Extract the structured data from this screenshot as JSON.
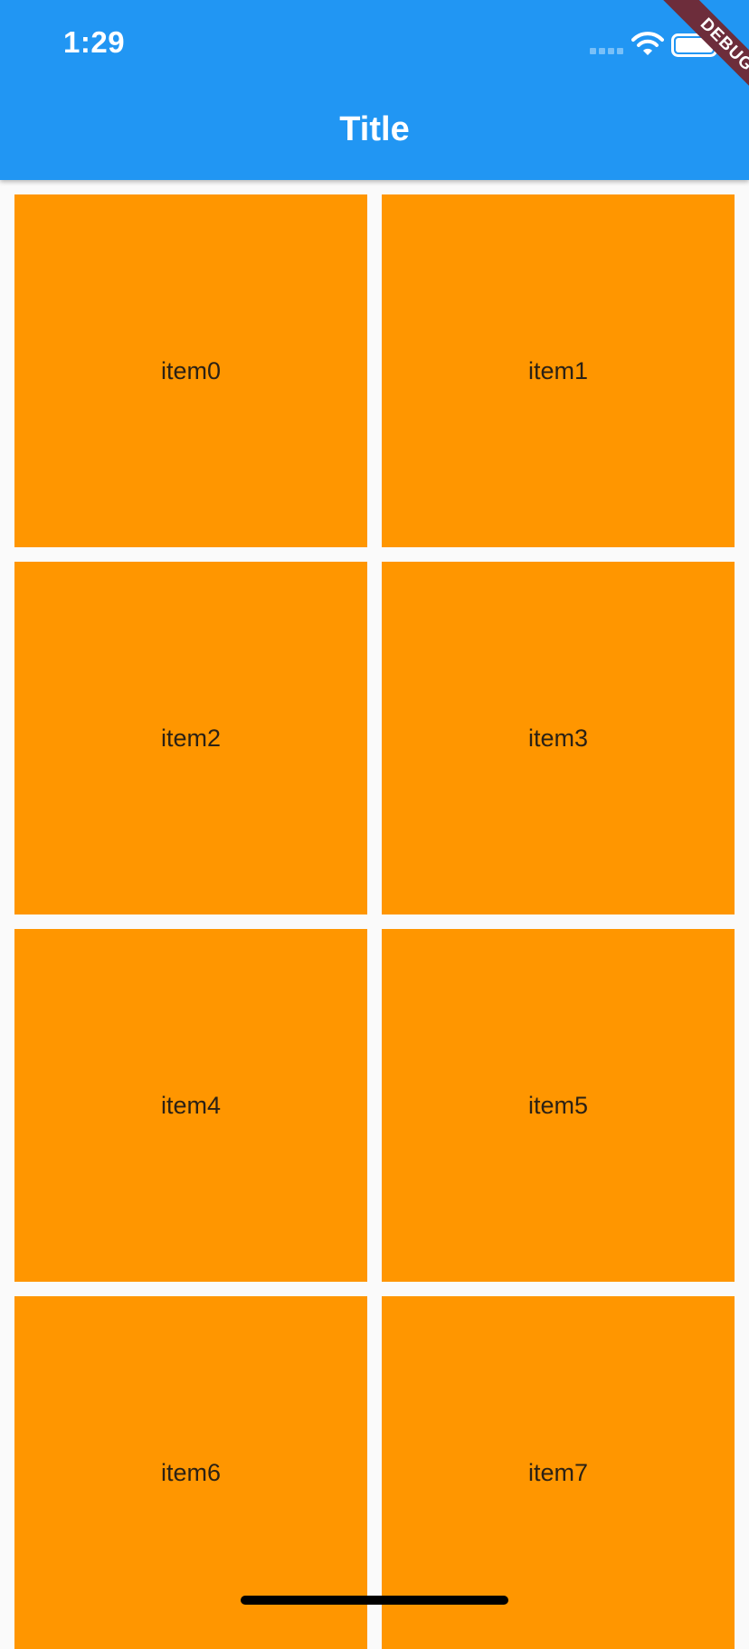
{
  "status_bar": {
    "time": "1:29",
    "icons": [
      "signal-icon",
      "wifi-icon",
      "battery-icon"
    ]
  },
  "app_bar": {
    "title": "Title",
    "background_color": "#2196f3"
  },
  "debug_banner": {
    "label": "DEBUG",
    "color": "#6d2d3b"
  },
  "grid": {
    "item_color": "#ff9600",
    "items": [
      {
        "label": "item0"
      },
      {
        "label": "item1"
      },
      {
        "label": "item2"
      },
      {
        "label": "item3"
      },
      {
        "label": "item4"
      },
      {
        "label": "item5"
      },
      {
        "label": "item6"
      },
      {
        "label": "item7"
      }
    ]
  }
}
